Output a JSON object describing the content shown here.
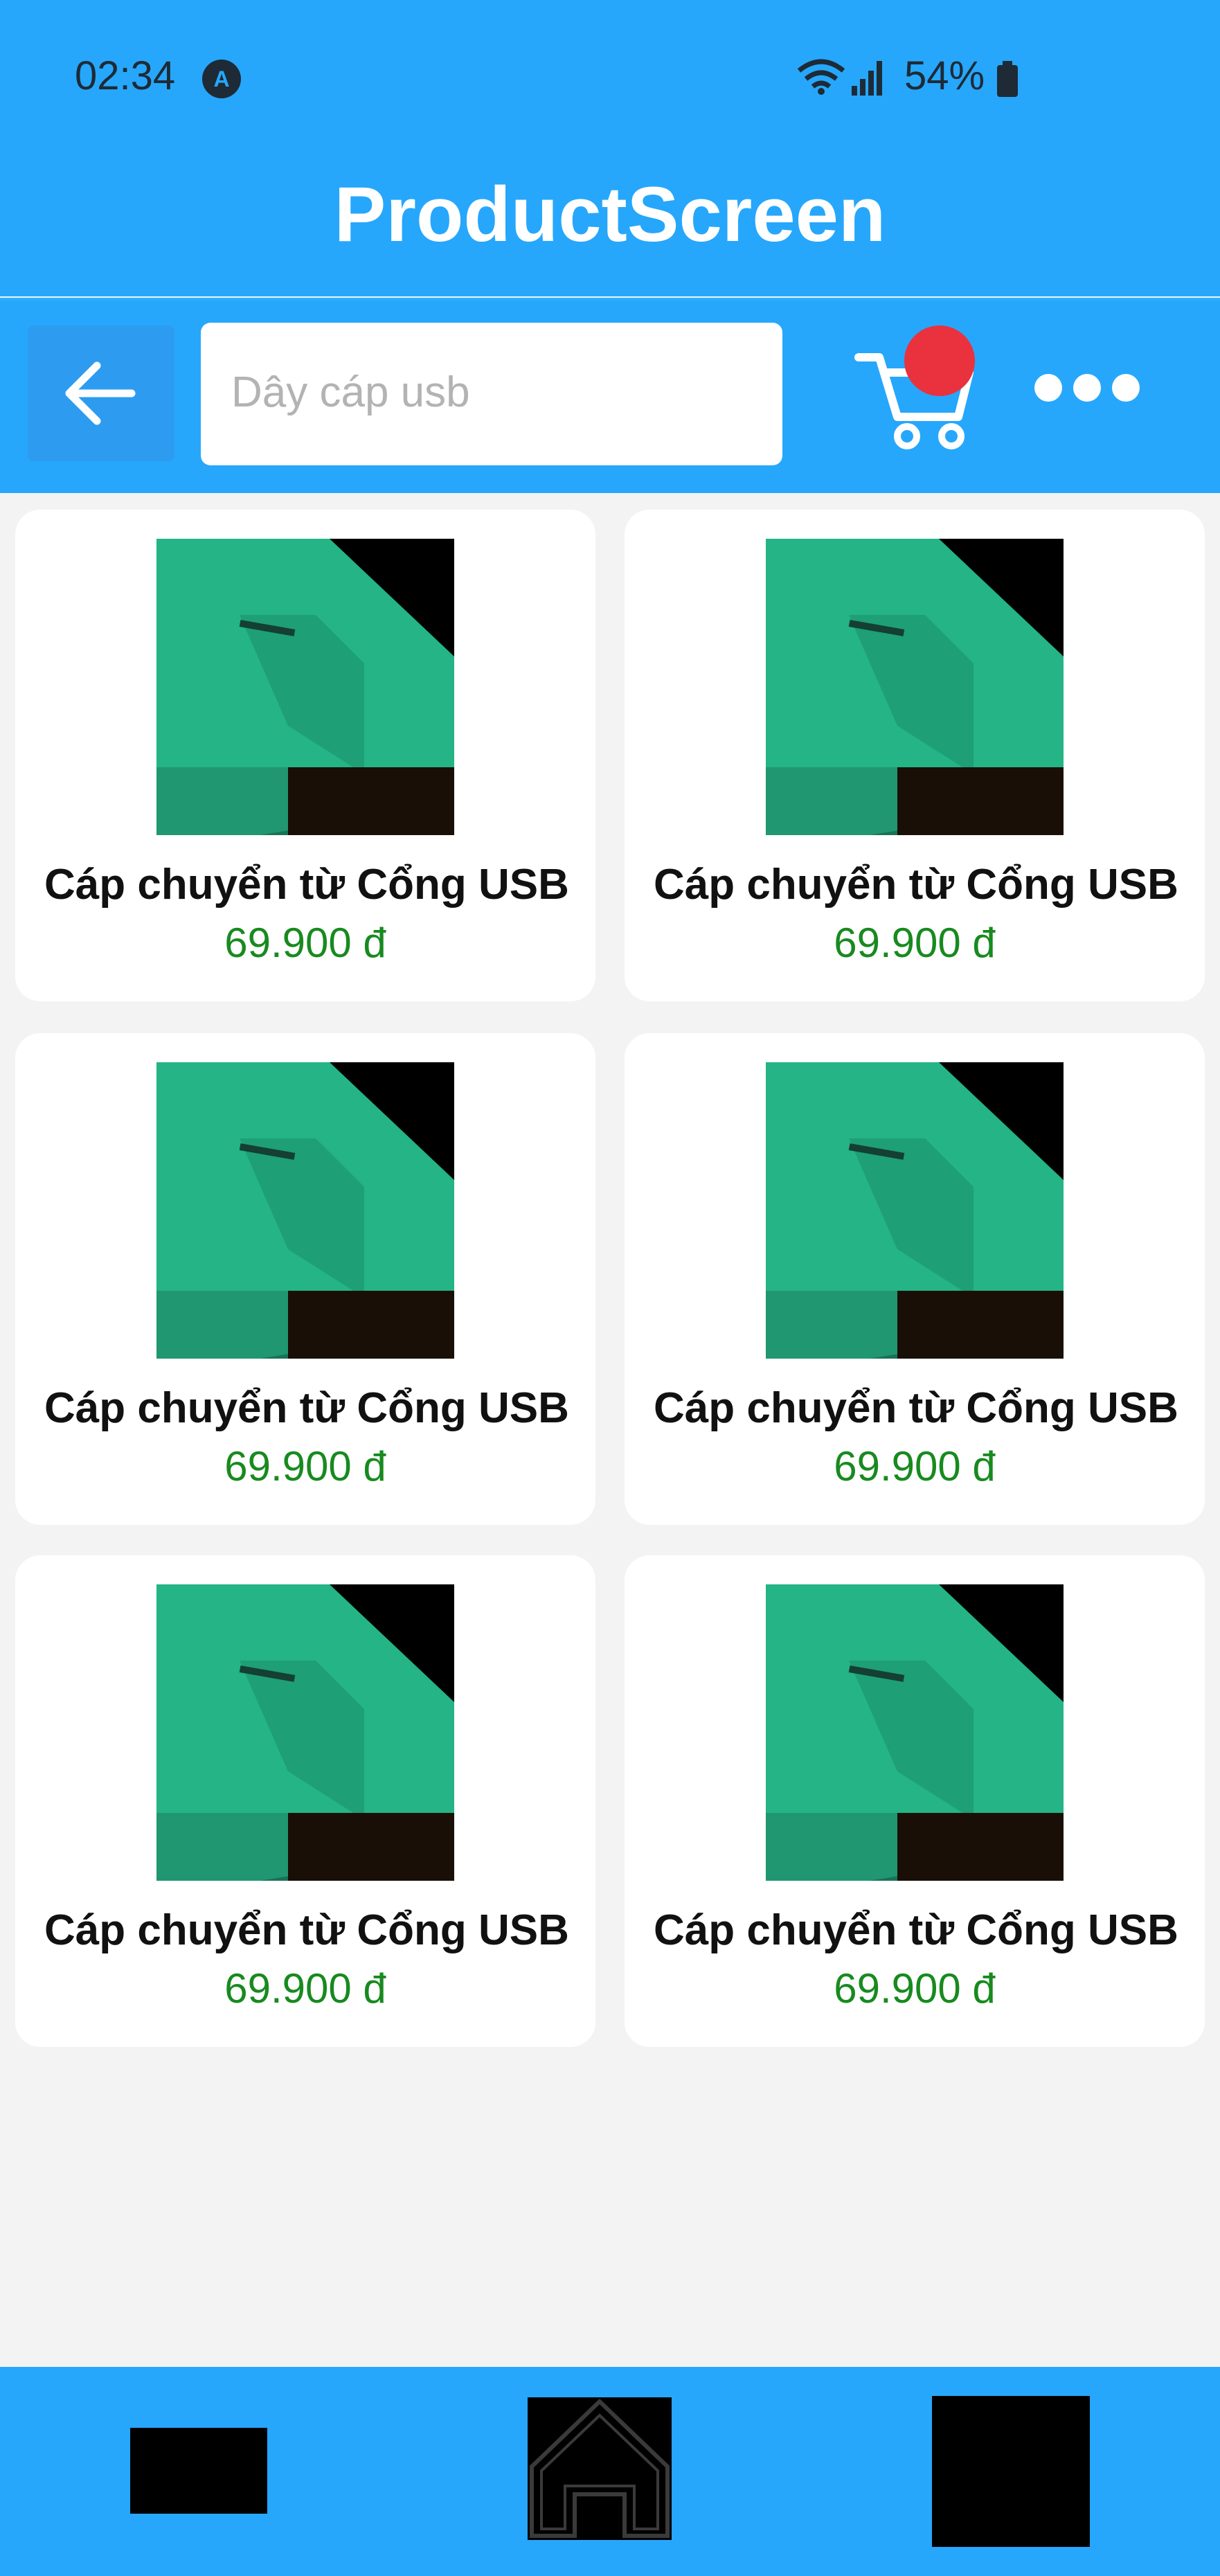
{
  "status_bar": {
    "time": "02:34",
    "app_icon": "A",
    "battery": "54%"
  },
  "header": {
    "title": "ProductScreen"
  },
  "toolbar": {
    "search_placeholder": "Dây cáp usb",
    "back_icon": "arrow-left-icon",
    "cart_icon": "cart-icon",
    "more_icon": "ellipsis-icon"
  },
  "products": [
    {
      "title": "Cáp chuyển từ Cổng USB",
      "price": "69.900 đ"
    },
    {
      "title": "Cáp chuyển từ Cổng USB",
      "price": "69.900 đ"
    },
    {
      "title": "Cáp chuyển từ Cổng USB",
      "price": "69.900 đ"
    },
    {
      "title": "Cáp chuyển từ Cổng USB",
      "price": "69.900 đ"
    },
    {
      "title": "Cáp chuyển từ Cổng USB",
      "price": "69.900 đ"
    },
    {
      "title": "Cáp chuyển từ Cổng USB",
      "price": "69.900 đ"
    }
  ],
  "colors": {
    "primary": "#26a7fb",
    "badge": "#e9323d",
    "price": "#188a1f",
    "background": "#f3f3f3"
  }
}
